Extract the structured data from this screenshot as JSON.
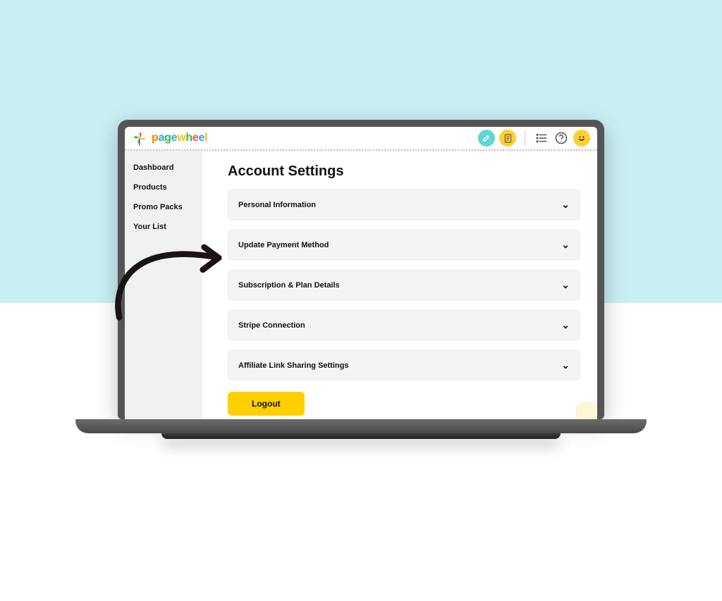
{
  "logo": {
    "text": "pagewheel"
  },
  "header_icons": {
    "rocket": "🚀",
    "doc": "📄",
    "list": "≡",
    "help": "?",
    "smiley": "☻"
  },
  "sidebar": {
    "items": [
      {
        "label": "Dashboard"
      },
      {
        "label": "Products"
      },
      {
        "label": "Promo Packs"
      },
      {
        "label": "Your List"
      }
    ]
  },
  "page": {
    "title": "Account Settings",
    "sections": [
      {
        "label": "Personal Information"
      },
      {
        "label": "Update Payment Method"
      },
      {
        "label": "Subscription & Plan Details"
      },
      {
        "label": "Stripe Connection"
      },
      {
        "label": "Affiliate Link Sharing Settings"
      }
    ],
    "logout_label": "Logout"
  }
}
